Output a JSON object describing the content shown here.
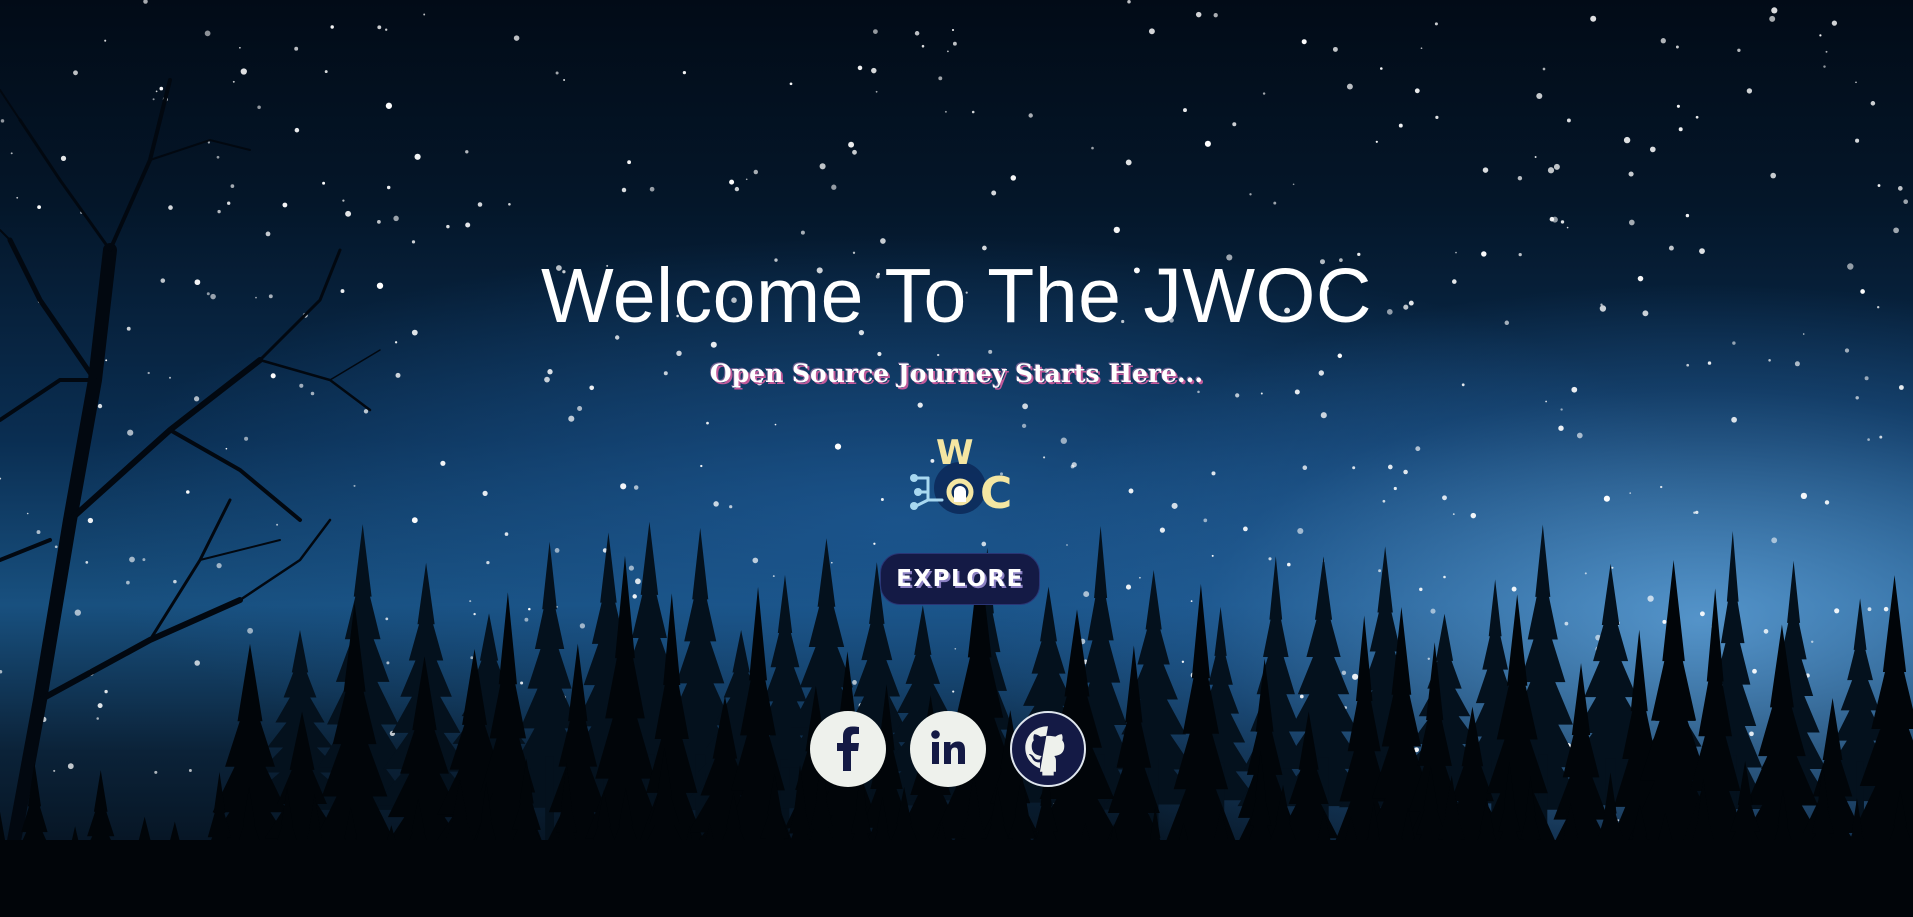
{
  "hero": {
    "title": "Welcome To The JWOC",
    "subtitle": "Open Source Journey Starts Here...",
    "logo": {
      "icon": "jwoc-logo",
      "text": "JWOC"
    },
    "explore_label": "EXPLORE"
  },
  "social": [
    {
      "icon": "facebook-icon"
    },
    {
      "icon": "linkedin-icon"
    },
    {
      "icon": "github-icon"
    }
  ],
  "colors": {
    "button_bg": "#141a45",
    "icon_circle_bg": "#eef1ec",
    "icon_fg": "#141a45",
    "subtitle_shadow": "#c05a9a",
    "logo_accent": "#f4e6a2",
    "logo_circuit": "#a8d8f0"
  }
}
